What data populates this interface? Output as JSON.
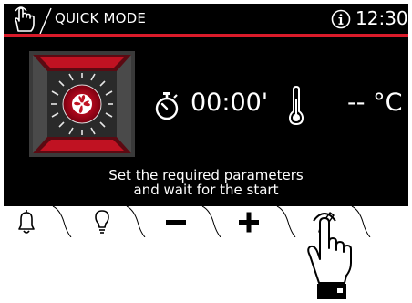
{
  "header": {
    "mode_title": "QUICK MODE",
    "clock": "12:30"
  },
  "icons": {
    "top_left": "touch-hand-icon",
    "info": "info-icon",
    "oven": "fan-oven-icon",
    "timer": "stopwatch-icon",
    "temperature": "thermometer-icon",
    "pointer": "pointing-hand-icon"
  },
  "main": {
    "timer_value": "00:00'",
    "temperature_value": "-- °C",
    "message_line1": "Set the required parameters",
    "message_line2": "and wait for the start"
  },
  "bottom_bar": {
    "buttons": [
      "bell-icon",
      "lightbulb-icon",
      "minus-icon",
      "plus-icon",
      "edit-pencil-icon"
    ]
  },
  "colors": {
    "accent": "#d91b2a",
    "background": "#000000",
    "bar": "#ffffff"
  }
}
